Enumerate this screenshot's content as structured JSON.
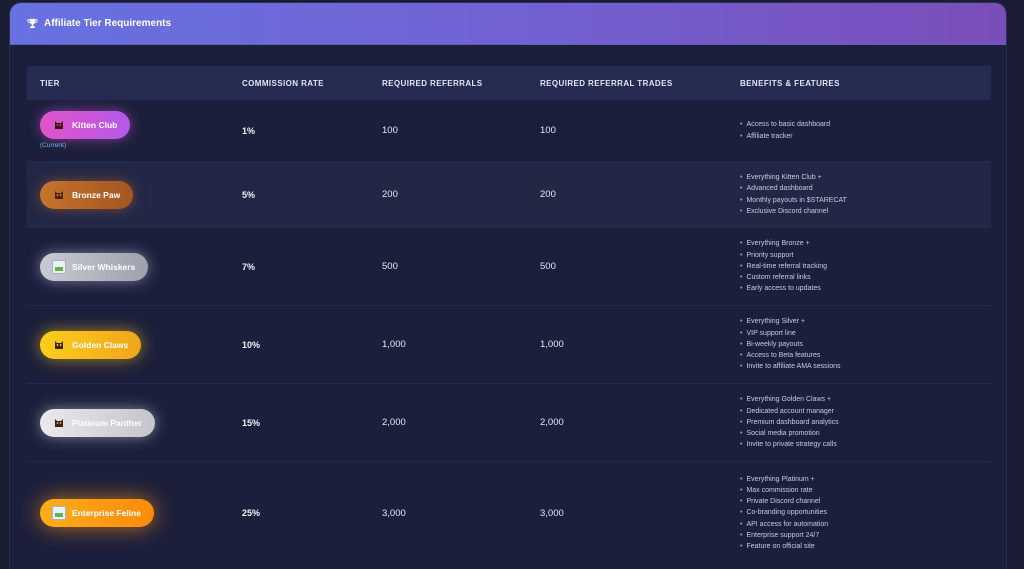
{
  "header": {
    "title": "Affiliate Tier Requirements",
    "icon": "trophy-icon"
  },
  "table": {
    "columns": [
      "TIER",
      "COMMISSION RATE",
      "REQUIRED REFERRALS",
      "REQUIRED REFERRAL TRADES",
      "BENEFITS & FEATURES"
    ],
    "rows": [
      {
        "tier": "Kitten Club",
        "status": "(Current)",
        "commission": "1%",
        "referrals": "100",
        "trades": "100",
        "benefits": [
          "Access to basic dashboard",
          "Affiliate tracker"
        ],
        "icon": "cat-icon",
        "color": "#d255d6"
      },
      {
        "tier": "Bronze Paw",
        "commission": "5%",
        "referrals": "200",
        "trades": "200",
        "benefits": [
          "Everything Kitten Club +",
          "Advanced dashboard",
          "Monthly payouts in $STARECAT",
          "Exclusive Discord channel"
        ],
        "icon": "cat-icon",
        "color": "#b8662a"
      },
      {
        "tier": "Silver Whiskers",
        "commission": "7%",
        "referrals": "500",
        "trades": "500",
        "benefits": [
          "Everything Bronze +",
          "Priority support",
          "Real-time referral tracking",
          "Custom referral links",
          "Early access to updates"
        ],
        "icon": "broken-image-icon",
        "color": "#b4b6c0"
      },
      {
        "tier": "Golden Claws",
        "commission": "10%",
        "referrals": "1,000",
        "trades": "1,000",
        "benefits": [
          "Everything Silver +",
          "VIP support line",
          "Bi-weekly payouts",
          "Access to Beta features",
          "Invite to affiliate AMA sessions"
        ],
        "icon": "cat-icon",
        "color": "#ffc21c"
      },
      {
        "tier": "Platinum Panther",
        "commission": "15%",
        "referrals": "2,000",
        "trades": "2,000",
        "benefits": [
          "Everything Golden Claws +",
          "Dedicated account manager",
          "Premium dashboard analytics",
          "Social media promotion",
          "Invite to private strategy calls"
        ],
        "icon": "cat-icon",
        "color": "#dcdce3"
      },
      {
        "tier": "Enterprise Feline",
        "commission": "25%",
        "referrals": "3,000",
        "trades": "3,000",
        "benefits": [
          "Everything Platinum +",
          "Max commission rate",
          "Private Discord channel",
          "Co-branding opportunities",
          "API access for automation",
          "Enterprise support 24/7",
          "Feature on official site"
        ],
        "icon": "broken-image-icon",
        "color": "#ff9c14"
      }
    ]
  }
}
